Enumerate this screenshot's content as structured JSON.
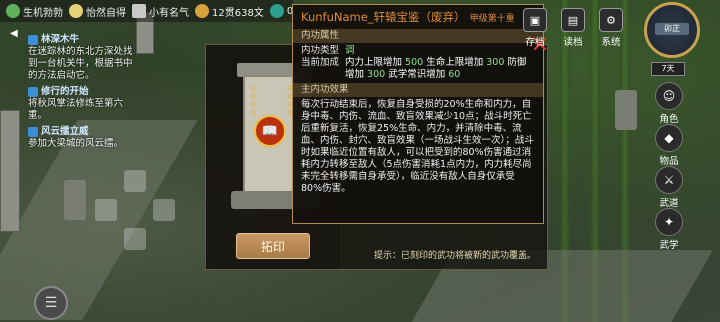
{
  "topbar": {
    "items": [
      {
        "label": "生机勃勃"
      },
      {
        "label": "怡然自得"
      },
      {
        "label": "小有名气"
      },
      {
        "label": "12贯638文"
      },
      {
        "label": "0"
      }
    ]
  },
  "quests": [
    {
      "title": "林深木牛",
      "desc": "在迷踪林的东北方深处找到一台机关牛，根据书中的方法启动它。"
    },
    {
      "title": "修行的开始",
      "desc": "将秋风掌法修炼至第六重。"
    },
    {
      "title": "风云擂立威",
      "desc": "参加大梁城的风云擂。"
    }
  ],
  "modal": {
    "imprint_label": "拓印",
    "hint": "提示：已刻印的武功将被新的武功覆盖。"
  },
  "tooltip": {
    "name": "KunfuName_轩辕宝鉴（废弃）",
    "grade": "甲级第十重",
    "section1": "内功属性",
    "type_key": "内功类型",
    "type_val": "调",
    "bonus_key": "当前加成",
    "bonus_parts": [
      "内力上限增加",
      "500",
      "生命上限增加",
      "300",
      "防御增加",
      "300",
      "武学常识增加",
      "60"
    ],
    "section2": "主内功效果",
    "effect": "每次行动结束后，恢复自身受损的20%生命和内力，自身中毒、内伤、流血、致盲效果减少10点；战斗时死亡后重新复活，恢复25%生命、内力，并清除中毒、流血、内伤、封穴、致盲效果（一场战斗生效一次）；战斗时如果临近位置有敌人，可以把受到的80%伤害通过消耗内力转移至敌人（5点伤害消耗1点内力，内力耗尽尚未完全转移需自身承受），临近没有敌人自身仅承受80%伤害。"
  },
  "hud": {
    "top_buttons": [
      {
        "label": "存档"
      },
      {
        "label": "读档"
      },
      {
        "label": "系统"
      }
    ],
    "clock_label": "卯正",
    "day": "7天",
    "side_buttons": [
      {
        "label": "角色"
      },
      {
        "label": "物品"
      },
      {
        "label": "武道"
      },
      {
        "label": "武学"
      }
    ]
  },
  "colors": {
    "accent_green": "#8fe08f",
    "title_orange": "#e08a3a",
    "quest_blue": "#3b8fd9"
  }
}
